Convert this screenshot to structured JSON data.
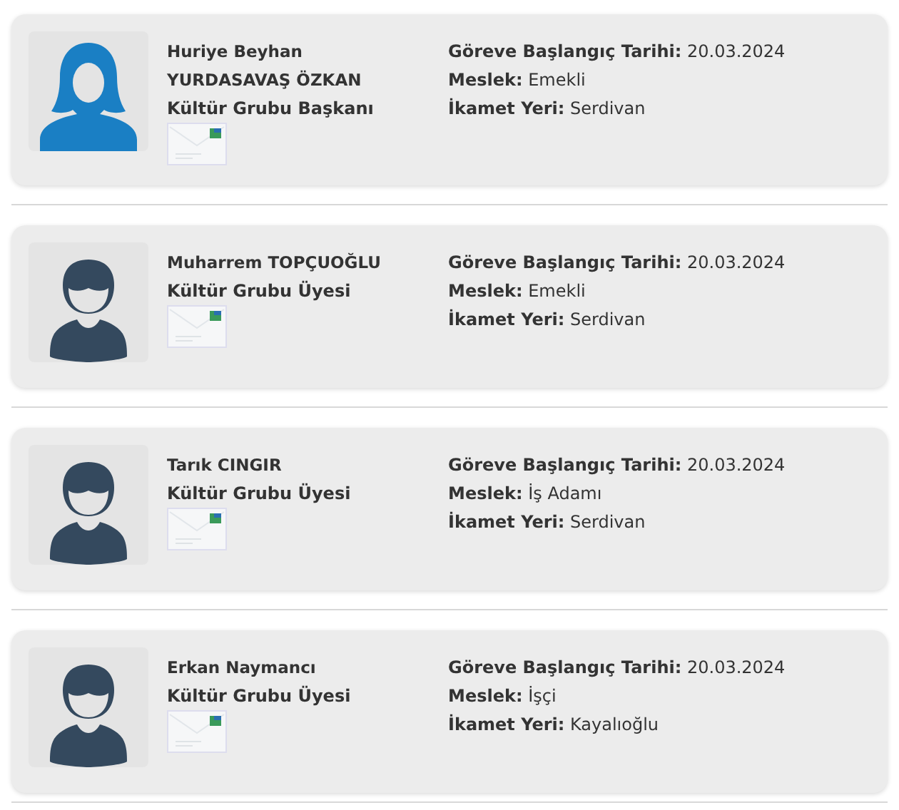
{
  "members": [
    {
      "avatar": {
        "kind": "female"
      },
      "name": "Huriye Beyhan YURDASAVAŞ ÖZKAN",
      "role": "Kültür Grubu Başkanı",
      "fields": [
        {
          "label": "Göreve Başlangıç Tarihi:",
          "value": "20.03.2024"
        },
        {
          "label": "Meslek:",
          "value": "Emekli"
        },
        {
          "label": "İkamet Yeri:",
          "value": "Serdivan"
        }
      ]
    },
    {
      "avatar": {
        "kind": "male"
      },
      "name": "Muharrem TOPÇUOĞLU",
      "role": "Kültür Grubu Üyesi",
      "fields": [
        {
          "label": "Göreve Başlangıç Tarihi:",
          "value": "20.03.2024"
        },
        {
          "label": "Meslek:",
          "value": "Emekli"
        },
        {
          "label": "İkamet Yeri:",
          "value": "Serdivan"
        }
      ]
    },
    {
      "avatar": {
        "kind": "male"
      },
      "name": "Tarık CINGIR",
      "role": "Kültür Grubu Üyesi",
      "fields": [
        {
          "label": "Göreve Başlangıç Tarihi:",
          "value": "20.03.2024"
        },
        {
          "label": "Meslek:",
          "value": "İş Adamı"
        },
        {
          "label": "İkamet Yeri:",
          "value": "Serdivan"
        }
      ]
    },
    {
      "avatar": {
        "kind": "male"
      },
      "name": "Erkan Naymancı",
      "role": "Kültür Grubu Üyesi",
      "fields": [
        {
          "label": "Göreve Başlangıç Tarihi:",
          "value": "20.03.2024"
        },
        {
          "label": "Meslek:",
          "value": "İşçi"
        },
        {
          "label": "İkamet Yeri:",
          "value": "Kayalıoğlu"
        }
      ]
    }
  ]
}
